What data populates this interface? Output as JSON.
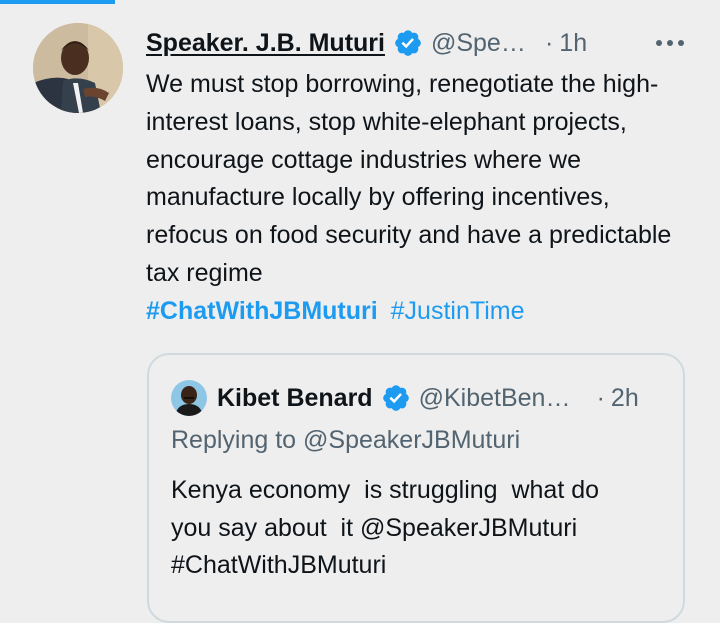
{
  "tweet": {
    "author_name": "Speaker. J.B. Muturi",
    "author_handle": "@SpeakerJBMuturi",
    "separator": "·",
    "time": "1h",
    "text": "We must stop borrowing, renegotiate the high-interest loans, stop white-elephant projects, encourage cottage industries where we manufacture locally by offering incentives, refocus on food security and have a predictable tax regime",
    "hashtag_primary": "#ChatWithJBMuturi",
    "hashtag_secondary": "#JustinTime"
  },
  "quoted_tweet": {
    "author_name": "Kibet Benard",
    "author_handle": "@KibetBenard",
    "separator": "·",
    "time": "2h",
    "replying_to": "Replying to @SpeakerJBMuturi",
    "text": "Kenya economy  is struggling  what do\nyou say about  it @SpeakerJBMuturi\n#ChatWithJBMuturi"
  },
  "icons": {
    "verified": "verified-badge-icon",
    "more": "more-options-icon"
  },
  "colors": {
    "background": "#eeeeee",
    "accent": "#1d9bf0",
    "secondary_text": "#536471",
    "border": "#cfd9de"
  }
}
